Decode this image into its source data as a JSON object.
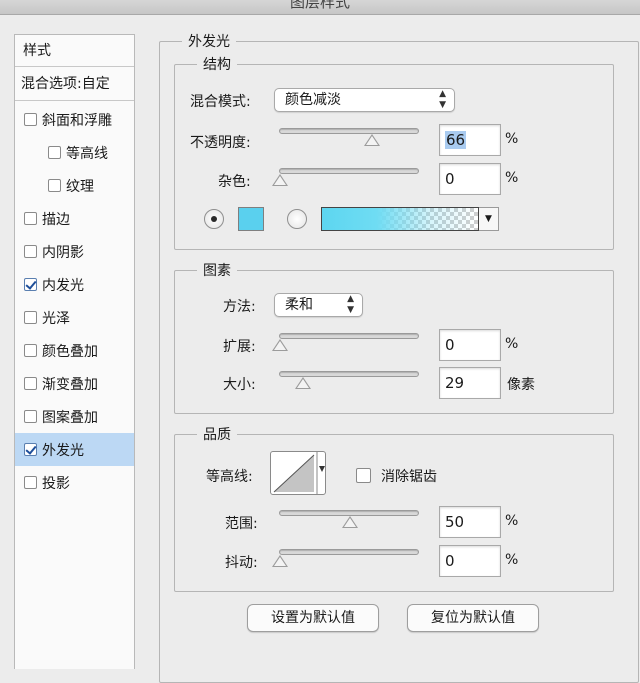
{
  "window": {
    "title": "图层样式"
  },
  "sidebar": {
    "heading": "样式",
    "blend_options": "混合选项:自定",
    "items": [
      {
        "label": "斜面和浮雕",
        "checked": false
      },
      {
        "label": "等高线",
        "checked": false
      },
      {
        "label": "纹理",
        "checked": false
      },
      {
        "label": "描边",
        "checked": false
      },
      {
        "label": "内阴影",
        "checked": false
      },
      {
        "label": "内发光",
        "checked": true
      },
      {
        "label": "光泽",
        "checked": false
      },
      {
        "label": "颜色叠加",
        "checked": false
      },
      {
        "label": "渐变叠加",
        "checked": false
      },
      {
        "label": "图案叠加",
        "checked": false
      },
      {
        "label": "外发光",
        "checked": true,
        "selected": true
      },
      {
        "label": "投影",
        "checked": false
      }
    ]
  },
  "panel": {
    "title": "外发光",
    "structure": {
      "title": "结构",
      "blend_mode_label": "混合模式:",
      "blend_mode_value": "颜色减淡",
      "opacity_label": "不透明度:",
      "opacity_value": "66",
      "opacity_unit": "%",
      "noise_label": "杂色:",
      "noise_value": "0",
      "noise_unit": "%",
      "color_swatch": "#5ad0ee",
      "gradient_color": "#5dd6f0"
    },
    "elements": {
      "title": "图素",
      "technique_label": "方法:",
      "technique_value": "柔和",
      "spread_label": "扩展:",
      "spread_value": "0",
      "spread_unit": "%",
      "size_label": "大小:",
      "size_value": "29",
      "size_unit": "像素"
    },
    "quality": {
      "title": "品质",
      "contour_label": "等高线:",
      "antialias_label": "消除锯齿",
      "antialias_checked": false,
      "range_label": "范围:",
      "range_value": "50",
      "range_unit": "%",
      "jitter_label": "抖动:",
      "jitter_value": "0",
      "jitter_unit": "%"
    },
    "buttons": {
      "make_default": "设置为默认值",
      "reset_default": "复位为默认值"
    }
  }
}
